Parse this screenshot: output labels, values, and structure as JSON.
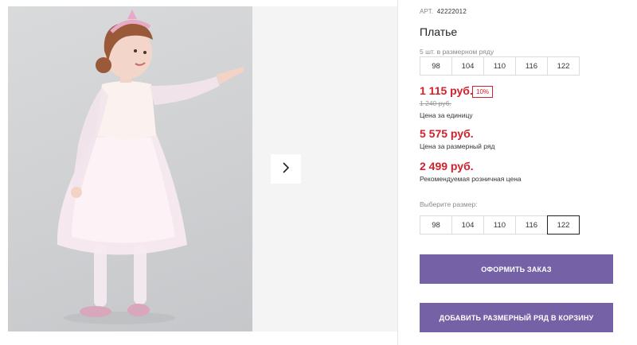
{
  "gallery": {
    "next_icon": "chevron-right-icon",
    "photo_alt": "Girl in a pink tulle party dress with sheer polka-dot sleeves, white tights and pink shoes"
  },
  "product": {
    "art_label": "АРТ.",
    "art_value": "42222012",
    "title": "Платье"
  },
  "size_set": {
    "label": "5 шт. в размерном ряду",
    "sizes": [
      "98",
      "104",
      "110",
      "116",
      "122"
    ]
  },
  "pricing": {
    "unit_price": "1 115 руб.",
    "discount_badge": "10%",
    "old_price": "1 240 руб.",
    "unit_caption": "Цена за единицу",
    "set_price": "5 575 руб.",
    "set_caption": "Цена за размерный ряд",
    "retail_price": "2 499 руб.",
    "retail_caption": "Рекомендуемая розничная цена"
  },
  "size_choice": {
    "label": "Выберите размер:",
    "sizes": [
      "98",
      "104",
      "110",
      "116",
      "122"
    ],
    "selected": "122"
  },
  "actions": {
    "order_label": "ОФОРМИТЬ ЗАКАЗ",
    "add_set_label": "ДОБАВИТЬ РАЗМЕРНЫЙ РЯД В КОРЗИНУ"
  },
  "colors": {
    "accent": "#7561a6",
    "price": "#d3202a"
  }
}
